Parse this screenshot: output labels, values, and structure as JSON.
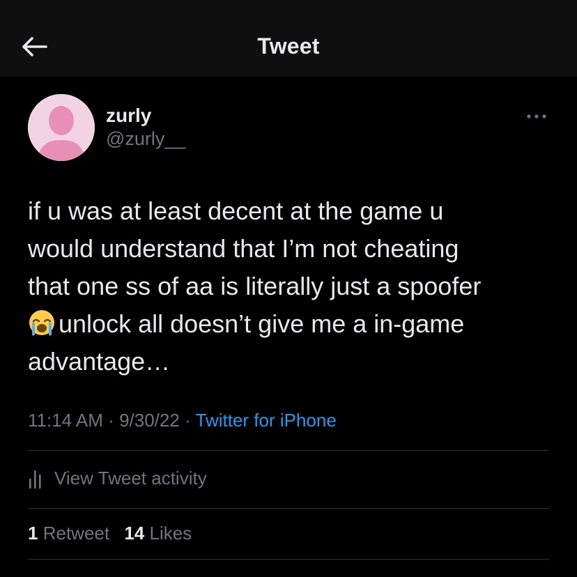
{
  "header": {
    "title": "Tweet",
    "back_icon": "arrow-left-icon"
  },
  "tweet": {
    "author": {
      "display_name": "zurly",
      "handle": "@zurly__",
      "avatar_icon": "default-profile-avatar-icon",
      "avatar_bg": "#f2d3e4",
      "avatar_fg": "#e88fb8"
    },
    "more_icon": "more-horizontal-icon",
    "text": {
      "lines_before_emoji": [
        "if u was at least decent at the game u",
        "would understand that I’m not cheating",
        "that one ss of aa is literally just a spoofer"
      ],
      "emoji": "loudly-crying-face-emoji",
      "after_emoji": "unlock all doesn’t give me a in-game",
      "last_line": "advantage…"
    },
    "time": "11:14 AM",
    "date": "9/30/22",
    "separator": "·",
    "source": "Twitter for iPhone",
    "source_color": "#1d9bf0"
  },
  "activity": {
    "icon": "bar-chart-icon",
    "label": "View Tweet activity"
  },
  "stats": {
    "retweets_count": "1",
    "retweets_label": "Retweet",
    "likes_count": "14",
    "likes_label": "Likes"
  }
}
